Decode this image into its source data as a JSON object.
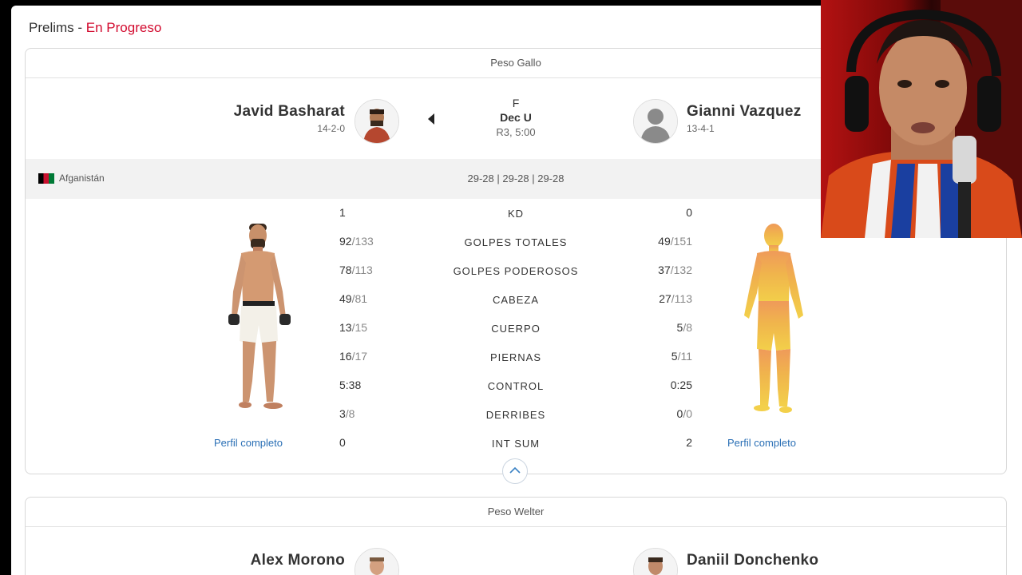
{
  "header": {
    "prefix": "Prelims",
    "separator": " - ",
    "status": "En Progreso"
  },
  "fight1": {
    "weight_class": "Peso Gallo",
    "red": {
      "name": "Javid Basharat",
      "record": "14-2-0",
      "country": "Afganistán",
      "profile_link": "Perfil completo"
    },
    "blue": {
      "name": "Gianni Vazquez",
      "record": "13-4-1",
      "profile_link": "Perfil completo"
    },
    "result": {
      "line1": "F",
      "method": "Dec U",
      "time": "R3, 5:00"
    },
    "scorecards": "29-28 | 29-28 | 29-28",
    "stats": [
      {
        "label": "KD",
        "red_main": "1",
        "red_sub": "",
        "blue_main": "0",
        "blue_sub": ""
      },
      {
        "label": "GOLPES TOTALES",
        "red_main": "92",
        "red_sub": "/133",
        "blue_main": "49",
        "blue_sub": "/151"
      },
      {
        "label": "GOLPES PODEROSOS",
        "red_main": "78",
        "red_sub": "/113",
        "blue_main": "37",
        "blue_sub": "/132"
      },
      {
        "label": "CABEZA",
        "red_main": "49",
        "red_sub": "/81",
        "blue_main": "27",
        "blue_sub": "/113"
      },
      {
        "label": "CUERPO",
        "red_main": "13",
        "red_sub": "/15",
        "blue_main": "5",
        "blue_sub": "/8"
      },
      {
        "label": "PIERNAS",
        "red_main": "16",
        "red_sub": "/17",
        "blue_main": "5",
        "blue_sub": "/11"
      },
      {
        "label": "CONTROL",
        "red_main": "5:38",
        "red_sub": "",
        "blue_main": "0:25",
        "blue_sub": ""
      },
      {
        "label": "DERRIBES",
        "red_main": "3",
        "red_sub": "/8",
        "blue_main": "0",
        "blue_sub": "/0"
      },
      {
        "label": "INT SUM",
        "red_main": "0",
        "red_sub": "",
        "blue_main": "2",
        "blue_sub": ""
      }
    ]
  },
  "fight2": {
    "weight_class": "Peso Welter",
    "red": {
      "name": "Alex Morono"
    },
    "blue": {
      "name": "Daniil Donchenko"
    }
  },
  "colors": {
    "accent_red": "#d20a2e",
    "link_blue": "#2a6fb5",
    "silhouette_gold": "#f0c04a"
  }
}
